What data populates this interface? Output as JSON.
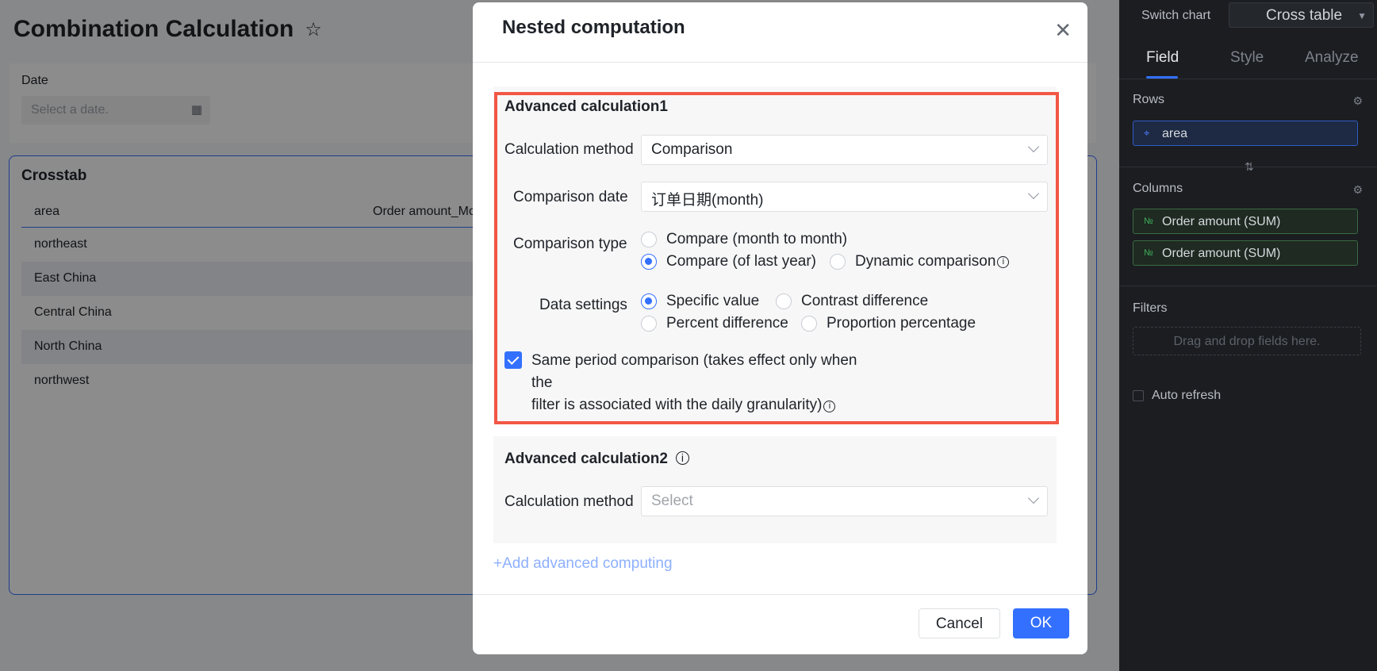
{
  "page": {
    "title": "Combination Calculation",
    "filter_label": "Date",
    "date_placeholder": "Select a date."
  },
  "crosstab": {
    "title": "Crosstab",
    "headers": [
      "area",
      "Order amount_Mon"
    ],
    "rows": [
      "northeast",
      "East China",
      "Central China",
      "North China",
      "northwest"
    ]
  },
  "side": {
    "switch_label": "Switch chart",
    "switch_value": "Cross table",
    "tabs": [
      "Field",
      "Style",
      "Analyze"
    ],
    "rows_label": "Rows",
    "rows_field": "area",
    "columns_label": "Columns",
    "columns_fields": [
      "Order amount (SUM)",
      "Order amount (SUM)"
    ],
    "filters_label": "Filters",
    "drop_hint": "Drag and drop fields here.",
    "auto_refresh": "Auto refresh"
  },
  "modal": {
    "title": "Nested computation",
    "calc1": {
      "title": "Advanced calculation1",
      "method_label": "Calculation method",
      "method_value": "Comparison",
      "date_label": "Comparison date",
      "date_value": "订单日期(month)",
      "type_label": "Comparison type",
      "type_options": [
        "Compare (month to month)",
        "Compare (of last year)",
        "Dynamic comparison"
      ],
      "type_selected": "Compare (of last year)",
      "data_label": "Data settings",
      "data_options": [
        "Specific value",
        "Contrast difference",
        "Percent difference",
        "Proportion percentage"
      ],
      "data_selected": "Specific value",
      "same_period_line1": "Same period comparison (takes effect only when the",
      "same_period_line2": "filter is associated with the daily granularity)",
      "same_period_checked": true
    },
    "calc2": {
      "title": "Advanced calculation2",
      "method_label": "Calculation method",
      "method_placeholder": "Select"
    },
    "add_link": "+Add advanced computing",
    "cancel": "Cancel",
    "ok": "OK"
  },
  "colors": {
    "accent": "#3370ff",
    "highlight": "#f25745",
    "side_bg": "#1b1d21"
  }
}
